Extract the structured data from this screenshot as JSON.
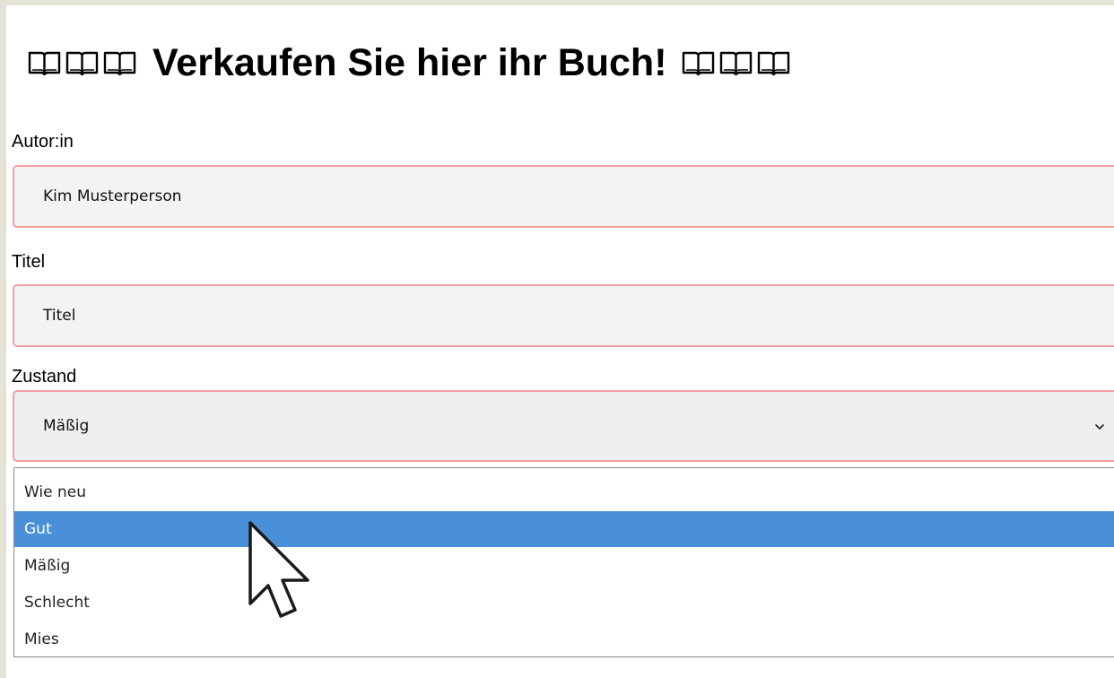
{
  "header": {
    "title": "Verkaufen Sie hier ihr Buch!",
    "decoration_icon": "open-book-icon",
    "decoration_count_each_side": 3
  },
  "form": {
    "author": {
      "label": "Autor:in",
      "value": "Kim Musterperson"
    },
    "title": {
      "label": "Titel",
      "value": "Titel"
    },
    "condition": {
      "label": "Zustand",
      "selected": "Mäßig",
      "options": [
        "Wie neu",
        "Gut",
        "Mäßig",
        "Schlecht",
        "Mies"
      ],
      "highlighted_option": "Gut"
    }
  },
  "colors": {
    "field_border": "#f0a0a0",
    "highlight": "#4a90d9",
    "outer_background": "#e4e3d5"
  }
}
